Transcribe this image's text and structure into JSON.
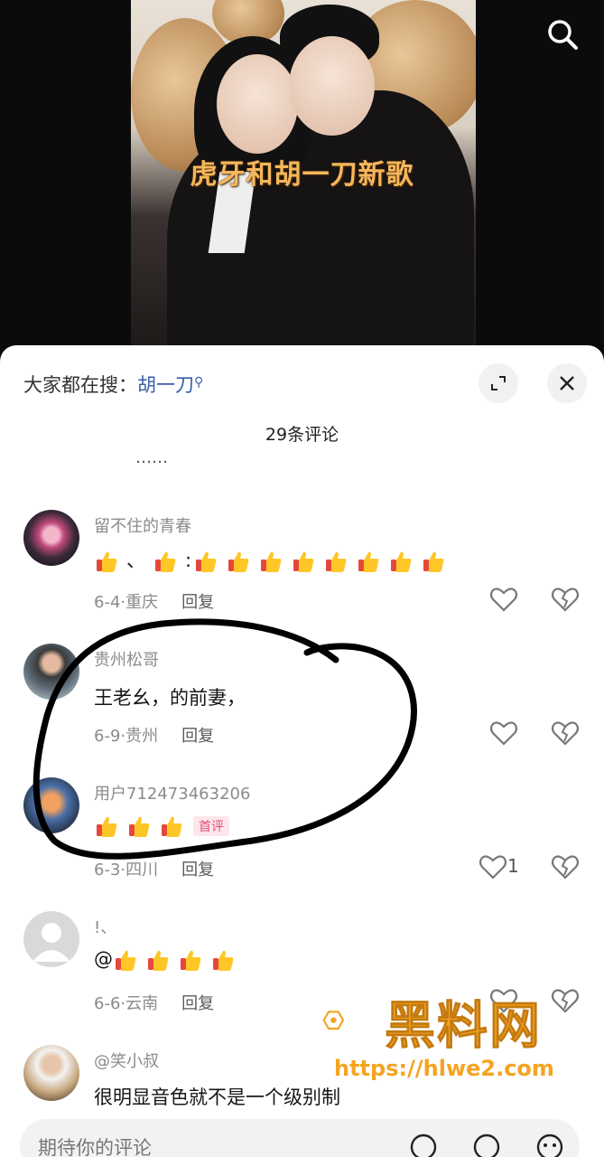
{
  "video": {
    "caption": "虎牙和胡一刀新歌",
    "search_icon": "search-icon"
  },
  "sheet": {
    "trend_prefix": "大家都在搜：",
    "trend_keyword": "胡一刀",
    "comment_count": "29条评论",
    "cut_text": "……",
    "icons": {
      "expand": "expand-icon",
      "close": "close-icon"
    }
  },
  "comments": [
    {
      "username": "留不住的青春",
      "text_prefix": "",
      "emoji": "thumbs-up",
      "date": "6-4",
      "location": "重庆",
      "reply_label": "回复",
      "likes": ""
    },
    {
      "username": "贵州松哥",
      "text": "王老幺，的前妻，",
      "date": "6-9",
      "location": "贵州",
      "reply_label": "回复",
      "likes": ""
    },
    {
      "username": "用户712473463206",
      "badge": "首评",
      "date": "6-3",
      "location": "四川",
      "reply_label": "回复",
      "likes": "1"
    },
    {
      "username": "!、",
      "text_prefix": "@",
      "date": "6-6",
      "location": "云南",
      "reply_label": "回复",
      "likes": ""
    },
    {
      "username": "@笑小叔",
      "text": "很明显音色就不是一个级别制",
      "likes": ""
    }
  ],
  "watermark": {
    "title": "黑料网",
    "url": "https://hlwe2.com"
  },
  "input": {
    "placeholder": "期待你的评论"
  },
  "colors": {
    "accent_link": "#3a5ea8",
    "caption": "#f5b75a",
    "badge": "#e04f73",
    "watermark": "#f5a321"
  }
}
